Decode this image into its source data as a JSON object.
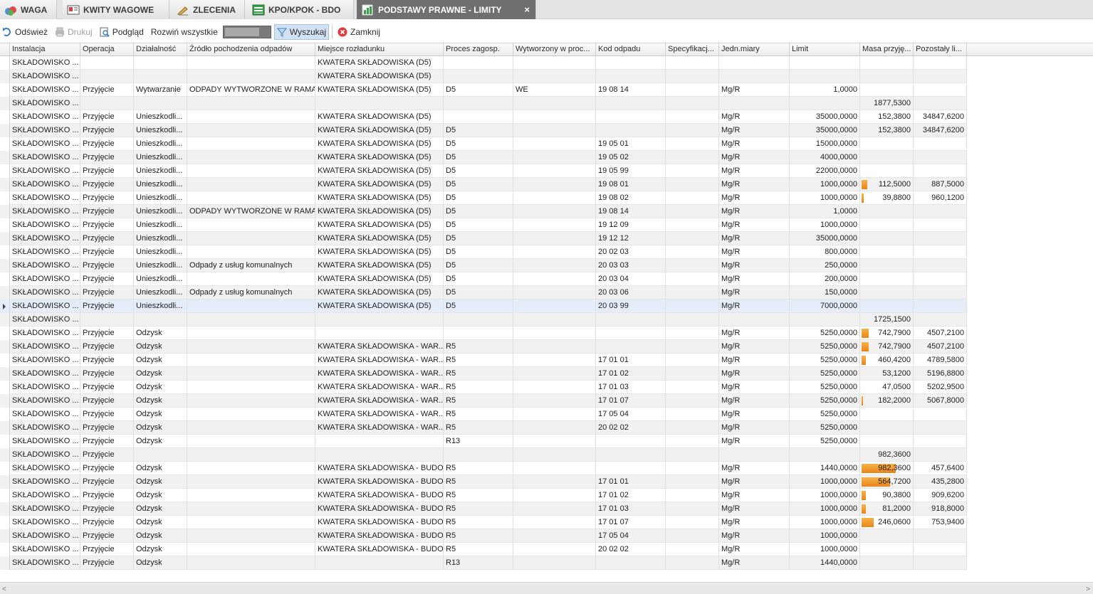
{
  "tabs": [
    {
      "label": "WAGA",
      "icon": "scale-icon"
    },
    {
      "label": "KWITY WAGOWE",
      "icon": "receipt-icon"
    },
    {
      "label": "ZLECENIA",
      "icon": "orders-icon"
    },
    {
      "label": "KPO/KPOK - BDO",
      "icon": "spreadsheet-icon"
    },
    {
      "label": "PODSTAWY PRAWNE - LIMITY",
      "icon": "limits-icon",
      "active": true
    }
  ],
  "tab_close_symbol": "×",
  "toolbar": {
    "refresh": "Odśwież",
    "print": "Drukuj",
    "preview": "Podgląd",
    "expand_all": "Rozwiń wszystkie",
    "search": "Wyszukaj",
    "close": "Zamknij"
  },
  "colors": {
    "accent_bar": "#e8841a",
    "active_tab": "#6f6f6f",
    "row_alt": "#f1f1f1",
    "row_selected": "#e5eef8"
  },
  "grid": {
    "columns": [
      "Instalacja",
      "Operacja",
      "Działalność",
      "Źródło pochodzenia odpadów",
      "Miejsce rozładunku",
      "Proces zagosp.",
      "Wytworzony w proc...",
      "Kod odpadu",
      "Specyfikacj...",
      "Jedn.miary",
      "Limit",
      "Masa przyję...",
      "Pozostały li..."
    ],
    "rows": [
      {
        "c": [
          "SKŁADOWISKO ...",
          "",
          "",
          "",
          "KWATERA SKŁADOWISKA (D5)",
          "",
          "",
          "",
          "",
          "",
          "",
          "",
          ""
        ]
      },
      {
        "c": [
          "SKŁADOWISKO ...",
          "",
          "",
          "",
          "KWATERA SKŁADOWISKA (D5)",
          "",
          "",
          "",
          "",
          "",
          "",
          "",
          ""
        ]
      },
      {
        "c": [
          "SKŁADOWISKO ...",
          "Przyjęcie",
          "Wytwarzanie",
          "ODPADY WYTWORZONE W RAMA...",
          "KWATERA SKŁADOWISKA (D5)",
          "D5",
          "WE",
          "19 08 14",
          "",
          "Mg/R",
          "1,0000",
          "",
          ""
        ]
      },
      {
        "c": [
          "SKŁADOWISKO ...",
          "",
          "",
          "",
          "",
          "",
          "",
          "",
          "",
          "",
          "",
          "1877,5300",
          ""
        ]
      },
      {
        "c": [
          "SKŁADOWISKO ...",
          "Przyjęcie",
          "Unieszkodli...",
          "",
          "KWATERA SKŁADOWISKA (D5)",
          "",
          "",
          "",
          "",
          "Mg/R",
          "35000,0000",
          "152,3800",
          "34847,6200"
        ]
      },
      {
        "c": [
          "SKŁADOWISKO ...",
          "Przyjęcie",
          "Unieszkodli...",
          "",
          "KWATERA SKŁADOWISKA (D5)",
          "D5",
          "",
          "",
          "",
          "Mg/R",
          "35000,0000",
          "152,3800",
          "34847,6200"
        ]
      },
      {
        "c": [
          "SKŁADOWISKO ...",
          "Przyjęcie",
          "Unieszkodli...",
          "",
          "KWATERA SKŁADOWISKA (D5)",
          "D5",
          "",
          "19 05 01",
          "",
          "Mg/R",
          "15000,0000",
          "",
          ""
        ]
      },
      {
        "c": [
          "SKŁADOWISKO ...",
          "Przyjęcie",
          "Unieszkodli...",
          "",
          "KWATERA SKŁADOWISKA (D5)",
          "D5",
          "",
          "19 05 02",
          "",
          "Mg/R",
          "4000,0000",
          "",
          ""
        ]
      },
      {
        "c": [
          "SKŁADOWISKO ...",
          "Przyjęcie",
          "Unieszkodli...",
          "",
          "KWATERA SKŁADOWISKA (D5)",
          "D5",
          "",
          "19 05 99",
          "",
          "Mg/R",
          "22000,0000",
          "",
          ""
        ]
      },
      {
        "c": [
          "SKŁADOWISKO ...",
          "Przyjęcie",
          "Unieszkodli...",
          "",
          "KWATERA SKŁADOWISKA (D5)",
          "D5",
          "",
          "19 08 01",
          "",
          "Mg/R",
          "1000,0000",
          "112,5000",
          "887,5000"
        ],
        "fill": 0.1125
      },
      {
        "c": [
          "SKŁADOWISKO ...",
          "Przyjęcie",
          "Unieszkodli...",
          "",
          "KWATERA SKŁADOWISKA (D5)",
          "D5",
          "",
          "19 08 02",
          "",
          "Mg/R",
          "1000,0000",
          "39,8800",
          "960,1200"
        ],
        "fill": 0.0399
      },
      {
        "c": [
          "SKŁADOWISKO ...",
          "Przyjęcie",
          "Unieszkodli...",
          "ODPADY WYTWORZONE W RAMA...",
          "KWATERA SKŁADOWISKA (D5)",
          "D5",
          "",
          "19 08 14",
          "",
          "Mg/R",
          "1,0000",
          "",
          ""
        ]
      },
      {
        "c": [
          "SKŁADOWISKO ...",
          "Przyjęcie",
          "Unieszkodli...",
          "",
          "KWATERA SKŁADOWISKA (D5)",
          "D5",
          "",
          "19 12 09",
          "",
          "Mg/R",
          "1000,0000",
          "",
          ""
        ]
      },
      {
        "c": [
          "SKŁADOWISKO ...",
          "Przyjęcie",
          "Unieszkodli...",
          "",
          "KWATERA SKŁADOWISKA (D5)",
          "D5",
          "",
          "19 12 12",
          "",
          "Mg/R",
          "35000,0000",
          "",
          ""
        ]
      },
      {
        "c": [
          "SKŁADOWISKO ...",
          "Przyjęcie",
          "Unieszkodli...",
          "",
          "KWATERA SKŁADOWISKA (D5)",
          "D5",
          "",
          "20 02 03",
          "",
          "Mg/R",
          "800,0000",
          "",
          ""
        ]
      },
      {
        "c": [
          "SKŁADOWISKO ...",
          "Przyjęcie",
          "Unieszkodli...",
          "Odpady z usług komunalnych",
          "KWATERA SKŁADOWISKA (D5)",
          "D5",
          "",
          "20 03 03",
          "",
          "Mg/R",
          "250,0000",
          "",
          ""
        ]
      },
      {
        "c": [
          "SKŁADOWISKO ...",
          "Przyjęcie",
          "Unieszkodli...",
          "",
          "KWATERA SKŁADOWISKA (D5)",
          "D5",
          "",
          "20 03 04",
          "",
          "Mg/R",
          "200,0000",
          "",
          ""
        ]
      },
      {
        "c": [
          "SKŁADOWISKO ...",
          "Przyjęcie",
          "Unieszkodli...",
          "Odpady z usług komunalnych",
          "KWATERA SKŁADOWISKA (D5)",
          "D5",
          "",
          "20 03 06",
          "",
          "Mg/R",
          "150,0000",
          "",
          ""
        ]
      },
      {
        "c": [
          "SKŁADOWISKO ...",
          "Przyjęcie",
          "Unieszkodli...",
          "",
          "KWATERA SKŁADOWISKA (D5)",
          "D5",
          "",
          "20 03 99",
          "",
          "Mg/R",
          "7000,0000",
          "",
          ""
        ],
        "selected": true
      },
      {
        "c": [
          "SKŁADOWISKO ...",
          "",
          "",
          "",
          "",
          "",
          "",
          "",
          "",
          "",
          "",
          "1725,1500",
          ""
        ]
      },
      {
        "c": [
          "SKŁADOWISKO ...",
          "Przyjęcie",
          "Odzysk",
          "",
          "",
          "",
          "",
          "",
          "",
          "Mg/R",
          "5250,0000",
          "742,7900",
          "4507,2100"
        ],
        "fill": 0.1415
      },
      {
        "c": [
          "SKŁADOWISKO ...",
          "Przyjęcie",
          "Odzysk",
          "",
          "KWATERA SKŁADOWISKA - WAR...",
          "R5",
          "",
          "",
          "",
          "Mg/R",
          "5250,0000",
          "742,7900",
          "4507,2100"
        ],
        "fill": 0.1415
      },
      {
        "c": [
          "SKŁADOWISKO ...",
          "Przyjęcie",
          "Odzysk",
          "",
          "KWATERA SKŁADOWISKA - WAR...",
          "R5",
          "",
          "17 01 01",
          "",
          "Mg/R",
          "5250,0000",
          "460,4200",
          "4789,5800"
        ],
        "fill": 0.0877
      },
      {
        "c": [
          "SKŁADOWISKO ...",
          "Przyjęcie",
          "Odzysk",
          "",
          "KWATERA SKŁADOWISKA - WAR...",
          "R5",
          "",
          "17 01 02",
          "",
          "Mg/R",
          "5250,0000",
          "53,1200",
          "5196,8800"
        ]
      },
      {
        "c": [
          "SKŁADOWISKO ...",
          "Przyjęcie",
          "Odzysk",
          "",
          "KWATERA SKŁADOWISKA - WAR...",
          "R5",
          "",
          "17 01 03",
          "",
          "Mg/R",
          "5250,0000",
          "47,0500",
          "5202,9500"
        ]
      },
      {
        "c": [
          "SKŁADOWISKO ...",
          "Przyjęcie",
          "Odzysk",
          "",
          "KWATERA SKŁADOWISKA - WAR...",
          "R5",
          "",
          "17 01 07",
          "",
          "Mg/R",
          "5250,0000",
          "182,2000",
          "5067,8000"
        ],
        "fill": 0.0347
      },
      {
        "c": [
          "SKŁADOWISKO ...",
          "Przyjęcie",
          "Odzysk",
          "",
          "KWATERA SKŁADOWISKA - WAR...",
          "R5",
          "",
          "17 05 04",
          "",
          "Mg/R",
          "5250,0000",
          "",
          ""
        ]
      },
      {
        "c": [
          "SKŁADOWISKO ...",
          "Przyjęcie",
          "Odzysk",
          "",
          "KWATERA SKŁADOWISKA - WAR...",
          "R5",
          "",
          "20 02 02",
          "",
          "Mg/R",
          "5250,0000",
          "",
          ""
        ]
      },
      {
        "c": [
          "SKŁADOWISKO ...",
          "Przyjęcie",
          "Odzysk",
          "",
          "",
          "R13",
          "",
          "",
          "",
          "Mg/R",
          "5250,0000",
          "",
          ""
        ]
      },
      {
        "c": [
          "SKŁADOWISKO ...",
          "Przyjęcie",
          "",
          "",
          "",
          "",
          "",
          "",
          "",
          "",
          "",
          "982,3600",
          ""
        ]
      },
      {
        "c": [
          "SKŁADOWISKO ...",
          "Przyjęcie",
          "Odzysk",
          "",
          "KWATERA SKŁADOWISKA - BUDO...",
          "R5",
          "",
          "",
          "",
          "Mg/R",
          "1440,0000",
          "982,3600",
          "457,6400"
        ],
        "fill": 0.682
      },
      {
        "c": [
          "SKŁADOWISKO ...",
          "Przyjęcie",
          "Odzysk",
          "",
          "KWATERA SKŁADOWISKA - BUDO...",
          "R5",
          "",
          "17 01 01",
          "",
          "Mg/R",
          "1000,0000",
          "564,7200",
          "435,2800"
        ],
        "fill": 0.5647
      },
      {
        "c": [
          "SKŁADOWISKO ...",
          "Przyjęcie",
          "Odzysk",
          "",
          "KWATERA SKŁADOWISKA - BUDO...",
          "R5",
          "",
          "17 01 02",
          "",
          "Mg/R",
          "1000,0000",
          "90,3800",
          "909,6200"
        ],
        "fill": 0.0904
      },
      {
        "c": [
          "SKŁADOWISKO ...",
          "Przyjęcie",
          "Odzysk",
          "",
          "KWATERA SKŁADOWISKA - BUDO...",
          "R5",
          "",
          "17 01 03",
          "",
          "Mg/R",
          "1000,0000",
          "81,2000",
          "918,8000"
        ],
        "fill": 0.0812
      },
      {
        "c": [
          "SKŁADOWISKO ...",
          "Przyjęcie",
          "Odzysk",
          "",
          "KWATERA SKŁADOWISKA - BUDO...",
          "R5",
          "",
          "17 01 07",
          "",
          "Mg/R",
          "1000,0000",
          "246,0600",
          "753,9400"
        ],
        "fill": 0.2461
      },
      {
        "c": [
          "SKŁADOWISKO ...",
          "Przyjęcie",
          "Odzysk",
          "",
          "KWATERA SKŁADOWISKA - BUDO...",
          "R5",
          "",
          "17 05 04",
          "",
          "Mg/R",
          "1000,0000",
          "",
          ""
        ]
      },
      {
        "c": [
          "SKŁADOWISKO ...",
          "Przyjęcie",
          "Odzysk",
          "",
          "KWATERA SKŁADOWISKA - BUDO...",
          "R5",
          "",
          "20 02 02",
          "",
          "Mg/R",
          "1000,0000",
          "",
          ""
        ]
      },
      {
        "c": [
          "SKŁADOWISKO ...",
          "Przyjęcie",
          "Odzysk",
          "",
          "",
          "R13",
          "",
          "",
          "",
          "Mg/R",
          "1440,0000",
          "",
          ""
        ]
      }
    ]
  },
  "scrollbar": {
    "left": "<",
    "right": ">"
  }
}
